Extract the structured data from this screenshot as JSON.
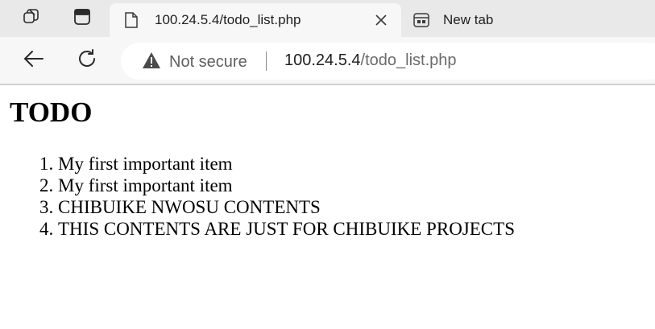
{
  "browser": {
    "active_tab": {
      "title": "100.24.5.4/todo_list.php",
      "icon": "page-icon",
      "close_icon": "close-icon"
    },
    "inactive_tab": {
      "title": "New tab",
      "icon": "new-tab-icon"
    },
    "toolbar": {
      "back_icon": "back-arrow-icon",
      "reload_icon": "reload-icon",
      "security_label": "Not secure",
      "security_icon": "warning-icon",
      "url_host": "100.24.5.4",
      "url_path": "/todo_list.php"
    }
  },
  "page": {
    "heading": "TODO",
    "items": [
      "My first important item",
      "My first important item",
      "CHIBUIKE NWOSU CONTENTS",
      "THIS CONTENTS ARE JUST FOR CHIBUIKE PROJECTS"
    ]
  }
}
